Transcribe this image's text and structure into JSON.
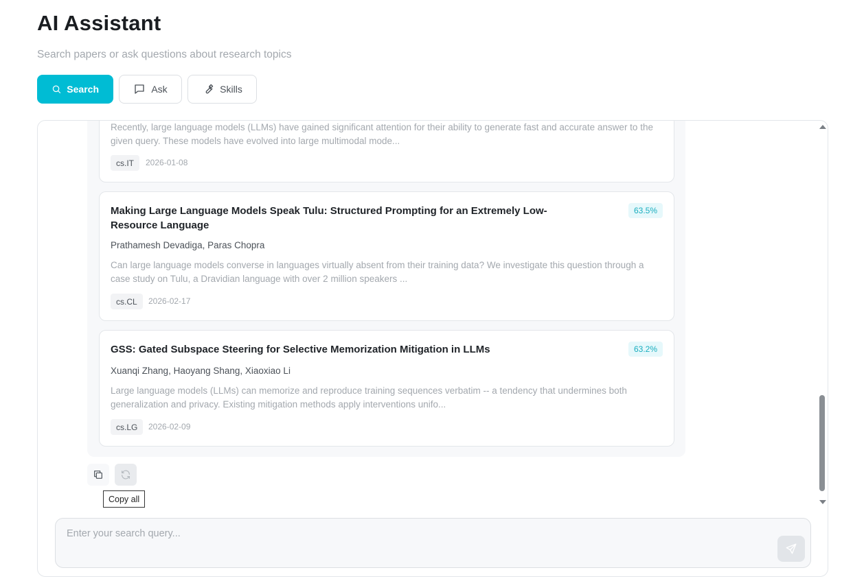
{
  "header": {
    "title": "AI Assistant",
    "subtitle": "Search papers or ask questions about research topics"
  },
  "tabs": [
    {
      "label": "Search",
      "icon": "search-icon",
      "active": true
    },
    {
      "label": "Ask",
      "icon": "chat-bubble-icon",
      "active": false
    },
    {
      "label": "Skills",
      "icon": "wrench-icon",
      "active": false
    }
  ],
  "results": [
    {
      "title": "",
      "authors": "",
      "abstract": "Recently, large language models (LLMs) have gained significant attention for their ability to generate fast and accurate answer to the given query. These models have evolved into large multimodal mode...",
      "category": "cs.IT",
      "date": "2026-01-08",
      "score": ""
    },
    {
      "title": "Making Large Language Models Speak Tulu: Structured Prompting for an Extremely Low-Resource Language",
      "authors": "Prathamesh Devadiga, Paras Chopra",
      "abstract": "Can large language models converse in languages virtually absent from their training data? We investigate this question through a case study on Tulu, a Dravidian language with over 2 million speakers ...",
      "category": "cs.CL",
      "date": "2026-02-17",
      "score": "63.5%"
    },
    {
      "title": "GSS: Gated Subspace Steering for Selective Memorization Mitigation in LLMs",
      "authors": "Xuanqi Zhang, Haoyang Shang, Xiaoxiao Li",
      "abstract": "Large language models (LLMs) can memorize and reproduce training sequences verbatim -- a tendency that undermines both generalization and privacy. Existing mitigation methods apply interventions unifo...",
      "category": "cs.LG",
      "date": "2026-02-09",
      "score": "63.2%"
    }
  ],
  "actions": {
    "copy_icon": "copy-icon",
    "regenerate_icon": "refresh-icon",
    "tooltip": "Copy all"
  },
  "input": {
    "placeholder": "Enter your search query...",
    "value": "",
    "send_icon": "send-icon"
  },
  "colors": {
    "accent": "#00bcd4",
    "score_text": "#1aaebf",
    "score_bg": "#e6f8fb"
  }
}
